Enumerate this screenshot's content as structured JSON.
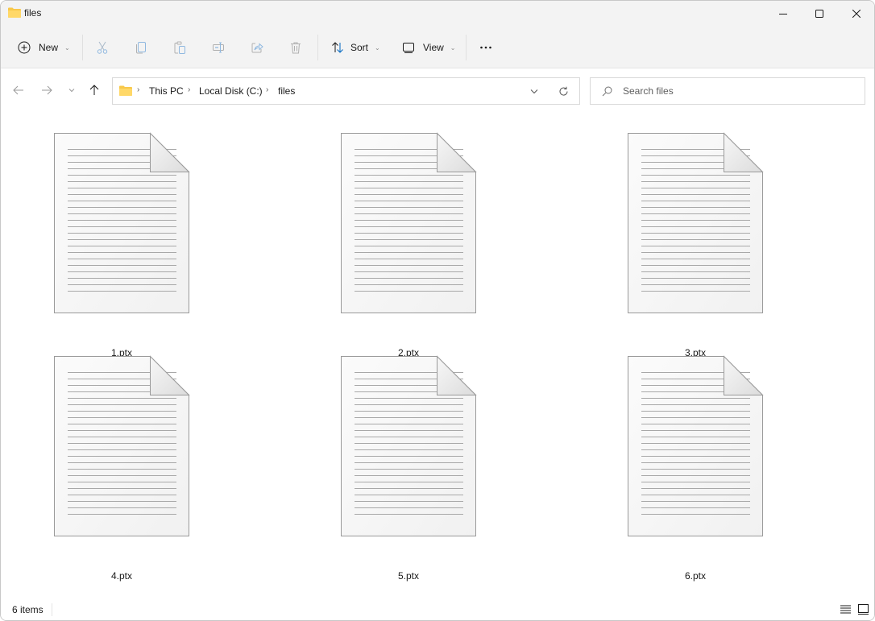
{
  "window": {
    "title": "files",
    "controls": {
      "minimize": "minimize-icon",
      "maximize": "maximize-icon",
      "close": "close-icon"
    }
  },
  "toolbar": {
    "new_label": "New",
    "sort_label": "Sort",
    "view_label": "View",
    "icons": [
      "add-circle-icon",
      "cut-icon",
      "copy-icon",
      "paste-icon",
      "rename-icon",
      "share-icon",
      "delete-icon",
      "sort-icon",
      "view-icon",
      "more-icon"
    ]
  },
  "navigation": {
    "breadcrumb": [
      "This PC",
      "Local Disk (C:)",
      "files"
    ],
    "search_placeholder": "Search files"
  },
  "files": [
    {
      "name": "1.ptx",
      "icon": "document-icon"
    },
    {
      "name": "2.ptx",
      "icon": "document-icon"
    },
    {
      "name": "3.ptx",
      "icon": "document-icon"
    },
    {
      "name": "4.ptx",
      "icon": "document-icon"
    },
    {
      "name": "5.ptx",
      "icon": "document-icon"
    },
    {
      "name": "6.ptx",
      "icon": "document-icon"
    }
  ],
  "status": {
    "item_count": "6 items"
  },
  "colors": {
    "folder": "#f8c84a",
    "accent": "#0067c0",
    "chrome_bg": "#f3f3f3"
  }
}
